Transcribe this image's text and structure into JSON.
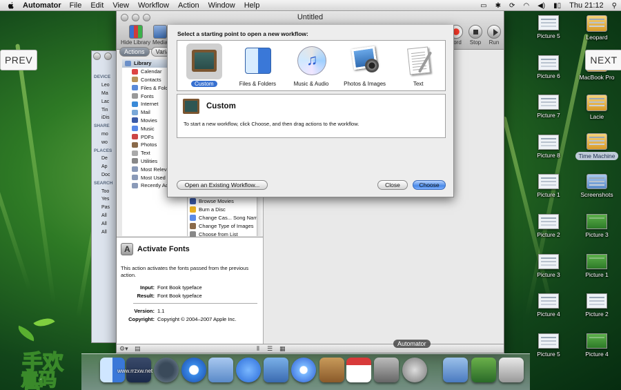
{
  "menubar": {
    "app_name": "Automator",
    "items": [
      "File",
      "Edit",
      "View",
      "Workflow",
      "Action",
      "Window",
      "Help"
    ],
    "clock": "Thu 21:12"
  },
  "nav": {
    "prev": "PREV",
    "next": "NEXT"
  },
  "desktop_icons": [
    {
      "label": "Leopard",
      "style": "drive"
    },
    {
      "label": "MacBook Pro",
      "style": "drive"
    },
    {
      "label": "Lacie",
      "style": "drive"
    },
    {
      "label": "Time Machine",
      "style": "drive"
    },
    {
      "label": "Screenshots",
      "style": "folder"
    },
    {
      "label": "Picture 3",
      "style": "green"
    },
    {
      "label": "Picture 1",
      "style": "green"
    },
    {
      "label": "Picture 2",
      "style": "doc"
    },
    {
      "label": "Picture 4",
      "style": "green"
    },
    {
      "label": "Picture 5",
      "style": "doc"
    },
    {
      "label": "Picture 6",
      "style": "doc"
    },
    {
      "label": "Picture 7",
      "style": "doc"
    },
    {
      "label": "Picture 8",
      "style": "doc"
    },
    {
      "label": "Picture 1",
      "style": "doc"
    },
    {
      "label": "Picture 2",
      "style": "doc"
    },
    {
      "label": "Picture 3",
      "style": "doc"
    },
    {
      "label": "Picture 4",
      "style": "doc"
    },
    {
      "label": "Picture 5",
      "style": "doc"
    }
  ],
  "window": {
    "title": "Untitled",
    "toolbar": {
      "hide_library": "Hide Library",
      "media": "Media",
      "record": "cord",
      "stop": "Stop",
      "run": "Run"
    },
    "segments": {
      "actions": "Actions",
      "variables": "Variab"
    },
    "library": [
      {
        "label": "Library",
        "head": true,
        "color": "#6b8fc8"
      },
      {
        "label": "Calendar",
        "color": "#d44"
      },
      {
        "label": "Contacts",
        "color": "#b8945a"
      },
      {
        "label": "Files & Folders",
        "color": "#5a8ad8"
      },
      {
        "label": "Fonts",
        "color": "#999"
      },
      {
        "label": "Internet",
        "color": "#3a8ad8"
      },
      {
        "label": "Mail",
        "color": "#7aa8d8"
      },
      {
        "label": "Movies",
        "color": "#3a5aa8"
      },
      {
        "label": "Music",
        "color": "#5a8ae8"
      },
      {
        "label": "PDFs",
        "color": "#c44"
      },
      {
        "label": "Photos",
        "color": "#8a6a4a"
      },
      {
        "label": "Text",
        "color": "#aaa"
      },
      {
        "label": "Utilities",
        "color": "#888"
      },
      {
        "label": "Most Relevant",
        "color": "#8a9ab8"
      },
      {
        "label": "Most Used",
        "color": "#8a9ab8"
      },
      {
        "label": "Recently Added",
        "color": "#8a9ab8"
      }
    ],
    "actions": [
      {
        "label": "Browse Movies",
        "color": "#3a5aa8"
      },
      {
        "label": "Burn a Disc",
        "color": "#e8b020"
      },
      {
        "label": "Change Cas... Song Names",
        "color": "#5a8ae8"
      },
      {
        "label": "Change Type of Images",
        "color": "#8a6a4a"
      },
      {
        "label": "Choose from List",
        "color": "#888"
      }
    ],
    "description": {
      "title": "Activate Fonts",
      "text": "This action activates the fonts passed from the previous action.",
      "input_label": "Input:",
      "input": "Font Book typeface",
      "result_label": "Result:",
      "result": "Font Book typeface",
      "version_label": "Version:",
      "version": "1.1",
      "copyright_label": "Copyright:",
      "copyright": "Copyright © 2004–2007 Apple Inc."
    }
  },
  "finder": {
    "rows": [
      "DEVICE",
      "Leo",
      "Ma",
      "Lac",
      "Tin",
      "iDis",
      "SHARE",
      "mo",
      "wo",
      "PLACES",
      "De",
      "Ap",
      "Doc",
      "SEARCH",
      "Too",
      "Yes",
      "Pas",
      "All",
      "All",
      "All"
    ]
  },
  "sheet": {
    "prompt": "Select a starting point to open a new workflow:",
    "choices": [
      {
        "label": "Custom",
        "selected": true,
        "art": "board"
      },
      {
        "label": "Files & Folders",
        "selected": false,
        "art": "finder"
      },
      {
        "label": "Music & Audio",
        "selected": false,
        "art": "cd"
      },
      {
        "label": "Photos & Images",
        "selected": false,
        "art": "photos"
      },
      {
        "label": "Text",
        "selected": false,
        "art": "text"
      }
    ],
    "detail_title": "Custom",
    "detail_text": "To start a new workflow, click Choose, and then drag actions to the workflow.",
    "open_existing": "Open an Existing Workflow...",
    "close": "Close",
    "choose": "Choose"
  },
  "dock": {
    "label": "Automator",
    "items": [
      "finder",
      "dashboard",
      "time-machine",
      "safari",
      "mail",
      "ichat",
      "iphoto",
      "itunes",
      "address-book",
      "ical",
      "system-preferences",
      "automator",
      "applications-folder",
      "pictures-stack",
      "trash"
    ]
  },
  "watermark": "www.rrzxw.net",
  "colors": {
    "accent": "#3770d0",
    "desktop": "#2e7a25"
  }
}
